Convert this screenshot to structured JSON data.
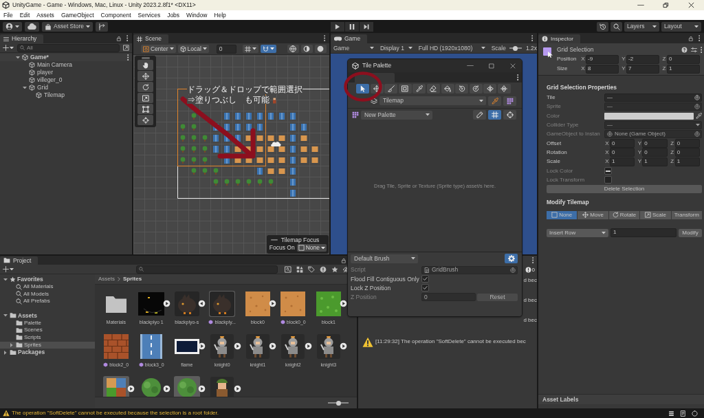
{
  "window": {
    "title": "UnityGame - Game - Windows, Mac, Linux - Unity 2023.2.8f1* <DX11>"
  },
  "menu": [
    "File",
    "Edit",
    "Assets",
    "GameObject",
    "Component",
    "Services",
    "Jobs",
    "Window",
    "Help"
  ],
  "toolbar": {
    "asset_store": "Asset Store",
    "layers": "Layers",
    "layout": "Layout"
  },
  "hierarchy": {
    "title": "Hierarchy",
    "search": {
      "placeholder": "All"
    },
    "tree": [
      {
        "label": "Game*",
        "kind": "scene",
        "expanded": true,
        "children": [
          {
            "label": "Main Camera",
            "kind": "object"
          },
          {
            "label": "player",
            "kind": "object"
          },
          {
            "label": "villeger_0",
            "kind": "object"
          },
          {
            "label": "Grid",
            "kind": "object",
            "expanded": true,
            "children": [
              {
                "label": "Tilemap",
                "kind": "object"
              }
            ]
          }
        ]
      }
    ]
  },
  "scene": {
    "title": "Scene",
    "pivot": "Center",
    "space": "Local",
    "snap_value": "0",
    "toggles": [
      {
        "kind": "grid",
        "selected": false
      },
      {
        "kind": "snap",
        "selected": true
      }
    ],
    "notes": [
      "ドラッグ＆ドロップで範囲選択",
      "⇒塗りつぶし　も可能"
    ],
    "focus": {
      "title": "Tilemap Focus",
      "label": "Focus On",
      "value": "None"
    }
  },
  "game": {
    "title": "Game",
    "view": "Game",
    "display": "Display 1",
    "resolution": "Full HD (1920x1080)",
    "scale": {
      "label": "Scale",
      "level": 0.45,
      "reading": "1.2x"
    }
  },
  "tile_palette": {
    "title": "Tile Palette",
    "tools": [
      {
        "kind": "select",
        "selected": true
      },
      {
        "kind": "move",
        "selected": false
      },
      {
        "kind": "paint",
        "selected": false
      },
      {
        "kind": "box",
        "selected": false
      },
      {
        "kind": "pick",
        "selected": false
      },
      {
        "kind": "erase",
        "selected": false
      },
      {
        "kind": "fill",
        "selected": false
      },
      {
        "kind": "rotate_left",
        "selected": false
      },
      {
        "kind": "rotate_right",
        "selected": false
      },
      {
        "kind": "flip_x",
        "selected": false
      },
      {
        "kind": "flip_y",
        "selected": false
      }
    ],
    "target": "Tilemap",
    "palette": "New Palette",
    "view_toggles": [
      {
        "kind": "edit",
        "selected": false
      },
      {
        "kind": "grid",
        "selected": true
      },
      {
        "kind": "gizmo",
        "selected": false
      }
    ],
    "hint": "Drag Tile, Sprite or Texture (Sprite type) asset/s here.",
    "brush": {
      "name": "Default Brush",
      "settings_selected": true,
      "fields": [
        {
          "kind": "object",
          "label": "Script",
          "value": "GridBrush",
          "disabled": true
        },
        {
          "kind": "checkbox",
          "label": "Flood Fill Contiguous Only",
          "checked": true,
          "disabled": false
        },
        {
          "kind": "checkbox",
          "label": "Lock Z Position",
          "checked": true,
          "disabled": false
        },
        {
          "kind": "number",
          "label": "Z Position",
          "value": "0",
          "button": "Reset",
          "disabled": true
        }
      ]
    }
  },
  "console": {
    "count": "0",
    "entries": [
      {
        "kind": "cut",
        "text": "d bec"
      },
      {
        "kind": "cut",
        "text": "d bec"
      },
      {
        "kind": "cut",
        "text": "d bec"
      },
      {
        "kind": "full",
        "text": "[11:29:32] The operation \"SoftDelete\" cannot be executed bec"
      }
    ]
  },
  "project": {
    "title": "Project",
    "tree": [
      {
        "label": "Favorites",
        "kind": "favorites",
        "expanded": true,
        "selected": false,
        "children": [
          {
            "label": "All Materials",
            "kind": "search",
            "selected": false
          },
          {
            "label": "All Models",
            "kind": "search",
            "selected": false
          },
          {
            "label": "All Prefabs",
            "kind": "search",
            "selected": false
          }
        ]
      },
      {
        "label": "Assets",
        "kind": "folder",
        "expanded": true,
        "selected": false,
        "children": [
          {
            "label": "Palette",
            "kind": "folder",
            "selected": false
          },
          {
            "label": "Scenes",
            "kind": "folder",
            "selected": false
          },
          {
            "label": "Scripts",
            "kind": "folder",
            "selected": false
          },
          {
            "label": "Sprites",
            "kind": "folder",
            "expanded": false,
            "selected": true
          }
        ]
      },
      {
        "label": "Packages",
        "kind": "folder",
        "expanded": false,
        "selected": false
      }
    ],
    "breadcrumb": [
      "Assets",
      "Sprites"
    ],
    "assets": [
      {
        "label": "Materials",
        "kind": "folder",
        "selected": false,
        "tile_asset": false
      },
      {
        "label": "blackplyo 1",
        "kind": "dark",
        "selected": false,
        "tile_asset": false,
        "expanded": false
      },
      {
        "label": "blackplyo-s",
        "kind": "bird",
        "selected": false,
        "tile_asset": false,
        "expanded": true
      },
      {
        "label": "blackply...",
        "kind": "bird",
        "selected": true,
        "tile_asset": true
      },
      {
        "label": "block0",
        "kind": "dirt",
        "selected": false,
        "tile_asset": false,
        "expanded": false
      },
      {
        "label": "block0_0",
        "kind": "dirt",
        "selected": false,
        "tile_asset": true
      },
      {
        "label": "block1",
        "kind": "grass",
        "selected": false,
        "tile_asset": false,
        "expanded": false
      },
      {
        "label": "block2_0",
        "kind": "brick",
        "selected": false,
        "tile_asset": true
      },
      {
        "label": "block3_0",
        "kind": "water",
        "selected": false,
        "tile_asset": true
      },
      {
        "label": "flame",
        "kind": "frame",
        "selected": false,
        "tile_asset": false,
        "expanded": false
      },
      {
        "label": "knight0",
        "kind": "knight",
        "selected": false,
        "tile_asset": false,
        "expanded": false
      },
      {
        "label": "knight1",
        "kind": "knight",
        "selected": false,
        "tile_asset": false,
        "expanded": false
      },
      {
        "label": "knight2",
        "kind": "knight",
        "selected": false,
        "tile_asset": false,
        "expanded": false
      },
      {
        "label": "knight3",
        "kind": "knight",
        "selected": false,
        "tile_asset": false,
        "expanded": false
      },
      {
        "kind": "tileset",
        "selected": true,
        "expanded": false
      },
      {
        "kind": "bush",
        "selected": false,
        "expanded": false
      },
      {
        "kind": "bush",
        "selected": true,
        "expanded": false
      },
      {
        "kind": "villager",
        "selected": false,
        "expanded": false
      }
    ],
    "zoom": {
      "level": 0.53
    }
  },
  "inspector": {
    "title": "Inspector",
    "object": "Grid Selection",
    "transform": [
      {
        "label": "Position",
        "values": [
          {
            "axis": "X",
            "value": "-9"
          },
          {
            "axis": "Y",
            "value": "-2"
          },
          {
            "axis": "Z",
            "value": "0"
          }
        ]
      },
      {
        "label": "Size",
        "values": [
          {
            "axis": "X",
            "value": "8"
          },
          {
            "axis": "Y",
            "value": "7"
          },
          {
            "axis": "Z",
            "value": "1"
          }
        ]
      }
    ],
    "section": "Grid Selection Properties",
    "properties": [
      {
        "kind": "object",
        "label": "Tile",
        "value": "—",
        "disabled": false
      },
      {
        "kind": "object",
        "label": "Sprite",
        "value": "—",
        "disabled": true
      },
      {
        "kind": "color",
        "label": "Color",
        "disabled": true
      },
      {
        "kind": "dropdown",
        "label": "Collider Type",
        "value": "—",
        "disabled": true
      },
      {
        "kind": "gameobject",
        "label": "GameObject to Instan",
        "value": "None (Game Object)",
        "disabled": true
      },
      {
        "kind": "vector",
        "label": "Offset",
        "disabled": false,
        "values": [
          {
            "axis": "X",
            "value": "0"
          },
          {
            "axis": "Y",
            "value": "0"
          },
          {
            "axis": "Z",
            "value": "0"
          }
        ]
      },
      {
        "kind": "vector",
        "label": "Rotation",
        "disabled": false,
        "values": [
          {
            "axis": "X",
            "value": "0"
          },
          {
            "axis": "Y",
            "value": "0"
          },
          {
            "axis": "Z",
            "value": "0"
          }
        ]
      },
      {
        "kind": "vector",
        "label": "Scale",
        "disabled": false,
        "values": [
          {
            "axis": "X",
            "value": "1"
          },
          {
            "axis": "Y",
            "value": "1"
          },
          {
            "axis": "Z",
            "value": "1"
          }
        ]
      },
      {
        "kind": "checkbox",
        "label": "Lock Color",
        "disabled": true,
        "mixed": true
      },
      {
        "kind": "checkbox",
        "label": "Lock Transform",
        "disabled": true,
        "mixed": false
      }
    ],
    "delete_button": "Delete Selection",
    "modify": {
      "title": "Modify Tilemap",
      "modes": [
        {
          "kind": "none",
          "label": "None",
          "selected": true
        },
        {
          "kind": "move",
          "label": "Move",
          "selected": false
        },
        {
          "kind": "rotate",
          "label": "Rotate",
          "selected": false
        },
        {
          "kind": "scale",
          "label": "Scale",
          "selected": false
        },
        {
          "kind": "transform",
          "label": "Transform",
          "selected": false
        }
      ],
      "operation": "Insert Row",
      "count": "1",
      "button": "Modify"
    },
    "asset_labels": "Asset Labels"
  },
  "status_bar": {
    "message": "The operation \"SoftDelete\" cannot be executed because the selection is a root folder."
  }
}
